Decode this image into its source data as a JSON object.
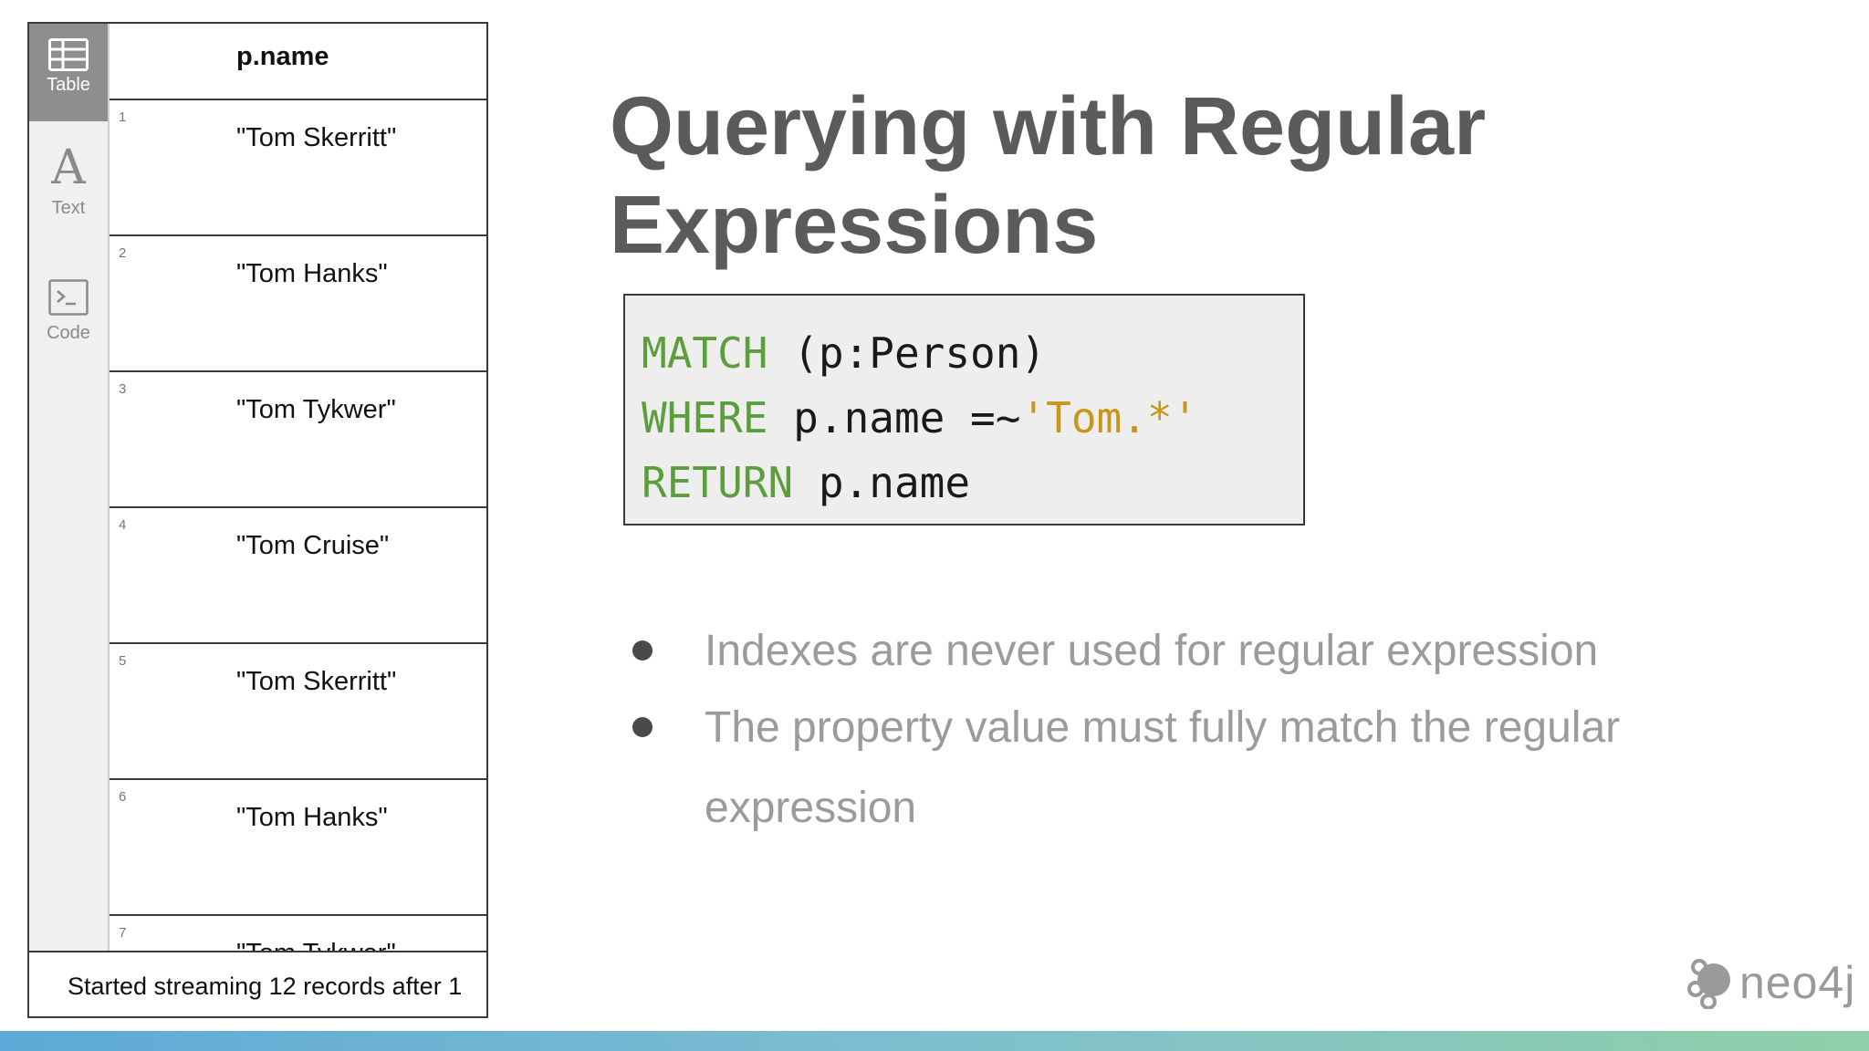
{
  "sidebar": {
    "views": [
      {
        "label": "Table",
        "icon": "table-icon",
        "active": true
      },
      {
        "label": "Text",
        "icon": "text-icon",
        "active": false
      },
      {
        "label": "Code",
        "icon": "code-icon",
        "active": false
      }
    ]
  },
  "results": {
    "column": "p.name",
    "rows": [
      {
        "index": "1",
        "value": "\"Tom Skerritt\""
      },
      {
        "index": "2",
        "value": "\"Tom Hanks\""
      },
      {
        "index": "3",
        "value": "\"Tom Tykwer\""
      },
      {
        "index": "4",
        "value": "\"Tom Cruise\""
      },
      {
        "index": "5",
        "value": "\"Tom Skerritt\""
      },
      {
        "index": "6",
        "value": "\"Tom Hanks\""
      },
      {
        "index": "7",
        "value": "\"Tom Tykwer\""
      }
    ],
    "status": "Started streaming 12 records after 1"
  },
  "slide": {
    "title_line1": "Querying with Regular",
    "title_line2": "Expressions",
    "code": {
      "line1_kw": "MATCH",
      "line1_rest": " (p:Person)",
      "line2_kw": "WHERE",
      "line2_rest": " p.name =~",
      "line2_str": "'Tom.*'",
      "line3_kw": "RETURN",
      "line3_rest": " p.name"
    },
    "bullets": [
      "Indexes are never used for regular expression",
      "The property value must fully match the regular expression"
    ]
  },
  "brand": {
    "logo_text": "neo4j"
  },
  "colors": {
    "keyword": "#5c9e3c",
    "string": "#c9961c",
    "title": "#5b5b5b",
    "bullet_text": "#9b9b9b",
    "bar_start": "#5da9d7",
    "bar_end": "#8fd0a8"
  }
}
